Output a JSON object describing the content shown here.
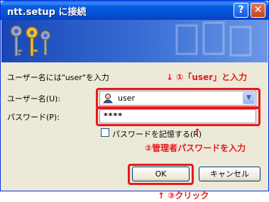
{
  "window": {
    "title": "ntt.setup に接続"
  },
  "titlebar": {
    "help_icon": "?",
    "close_icon": "✕"
  },
  "prompt": "ユーザー名には\"user\"を入力",
  "username": {
    "label": "ユーザー名(U):",
    "value": "user"
  },
  "password": {
    "label": "パスワード(P):",
    "value": "****"
  },
  "remember": {
    "label": "パスワードを記憶する(R)",
    "checked": false
  },
  "buttons": {
    "ok": "OK",
    "cancel": "キャンセル"
  },
  "annotations": {
    "step1": "↓ ①「user」と入力",
    "step2": "②管理者パスワードを入力",
    "step2_arrow": "↑",
    "step3": "↑ ③クリック"
  },
  "colors": {
    "annotation": "#e8181c",
    "title_bar": "#0a5ae0",
    "dialog_bg": "#ece9d8"
  }
}
